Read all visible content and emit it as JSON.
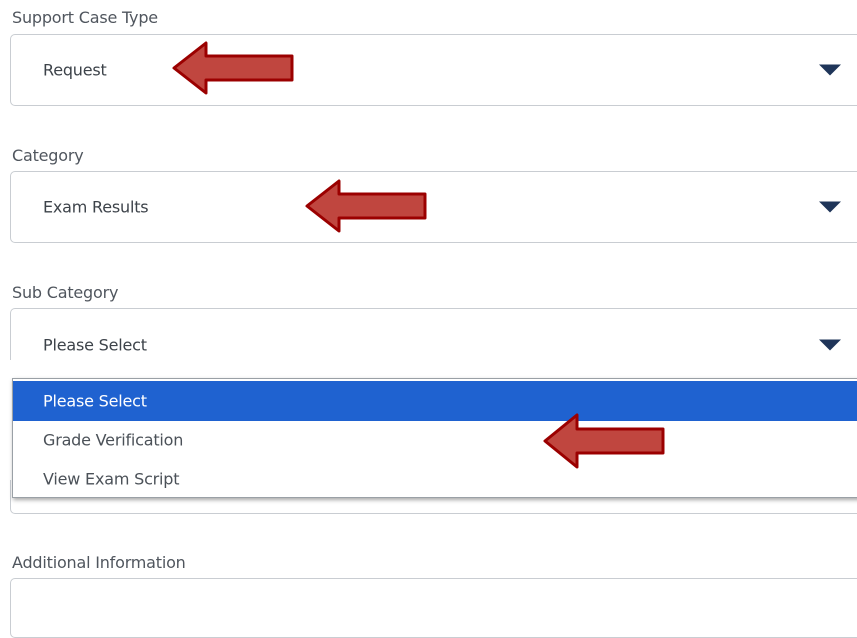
{
  "form": {
    "support_case_type": {
      "label": "Support Case Type",
      "value": "Request"
    },
    "category": {
      "label": "Category",
      "value": "Exam Results"
    },
    "sub_category": {
      "label": "Sub Category",
      "value": "Please Select",
      "options": [
        {
          "label": "Please Select",
          "selected": true
        },
        {
          "label": "Grade Verification",
          "selected": false
        },
        {
          "label": "View Exam Script",
          "selected": false
        }
      ]
    },
    "additional_information": {
      "label": "Additional Information",
      "value": ""
    }
  },
  "annotation_arrows": {
    "color": "#c0392b",
    "border_color": "#a30000",
    "direction": "left",
    "targets": [
      "support_case_type",
      "category",
      "sub_category_option_grade_verification"
    ]
  },
  "colors": {
    "selected_option_bg": "#1f62d0",
    "caret": "#1f3559"
  }
}
